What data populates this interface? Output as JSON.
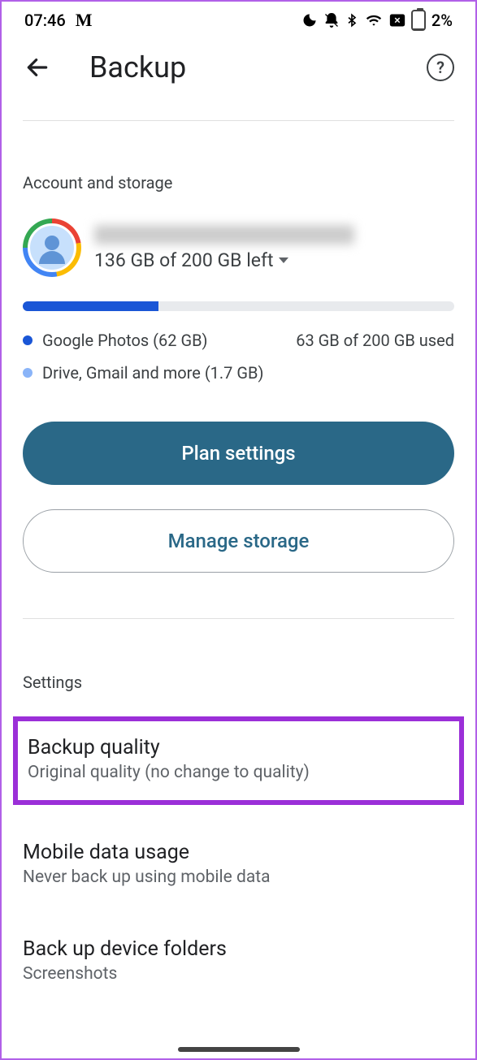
{
  "statusBar": {
    "time": "07:46",
    "batteryText": "2%"
  },
  "header": {
    "title": "Backup"
  },
  "accountSection": {
    "label": "Account and storage",
    "storageLeft": "136 GB of 200 GB left",
    "usageSummary": "63 GB of 200 GB used",
    "legend1": "Google Photos (62 GB)",
    "legend2": "Drive, Gmail and more (1.7 GB)"
  },
  "buttons": {
    "planSettings": "Plan settings",
    "manageStorage": "Manage storage"
  },
  "settings": {
    "label": "Settings",
    "backupQuality": {
      "title": "Backup quality",
      "sub": "Original quality (no change to quality)"
    },
    "mobileData": {
      "title": "Mobile data usage",
      "sub": "Never back up using mobile data"
    },
    "deviceFolders": {
      "title": "Back up device folders",
      "sub": "Screenshots"
    }
  }
}
